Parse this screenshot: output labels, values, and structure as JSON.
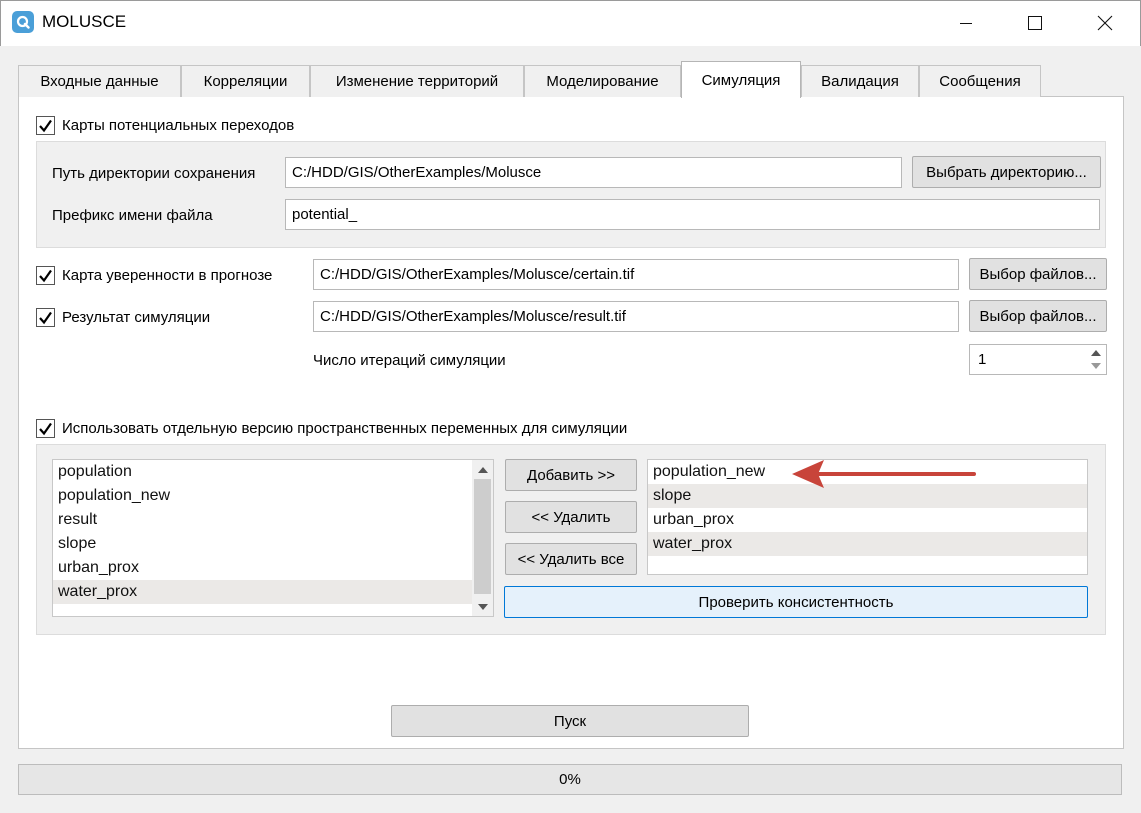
{
  "window": {
    "title": "MOLUSCE"
  },
  "tabs": [
    {
      "label": "Входные данные"
    },
    {
      "label": "Корреляции"
    },
    {
      "label": "Изменение территорий"
    },
    {
      "label": "Моделирование"
    },
    {
      "label": "Симуляция"
    },
    {
      "label": "Валидация"
    },
    {
      "label": "Сообщения"
    }
  ],
  "active_tab": "Симуляция",
  "potential": {
    "checkbox_label": "Карты потенциальных переходов",
    "checked": true,
    "dir_label": "Путь директории сохранения",
    "dir_value": "C:/HDD/GIS/OtherExamples/Molusce",
    "dir_button": "Выбрать директорию...",
    "prefix_label": "Префикс имени файла",
    "prefix_value": "potential_"
  },
  "certainty": {
    "checkbox_label": "Карта уверенности в прогнозе",
    "checked": true,
    "path": "C:/HDD/GIS/OtherExamples/Molusce/certain.tif",
    "button": "Выбор файлов..."
  },
  "result": {
    "checkbox_label": "Результат симуляции",
    "checked": true,
    "path": "C:/HDD/GIS/OtherExamples/Molusce/result.tif",
    "button": "Выбор файлов..."
  },
  "iterations": {
    "label": "Число итераций симуляции",
    "value": "1"
  },
  "separate_vars": {
    "checkbox_label": "Использовать отдельную версию пространственных переменных для симуляции",
    "checked": true,
    "available": [
      "population",
      "population_new",
      "result",
      "slope",
      "urban_prox",
      "water_prox"
    ],
    "available_selected_index": 5,
    "selected": [
      "population_new",
      "slope",
      "urban_prox",
      "water_prox"
    ],
    "add_button": "Добавить >>",
    "remove_button": "<< Удалить",
    "remove_all_button": "<< Удалить все",
    "check_button": "Проверить консистентность"
  },
  "run_button": "Пуск",
  "progress": {
    "text": "0%",
    "value": 0
  },
  "colors": {
    "annotation_arrow": "#c8443a",
    "accent": "#0078d7"
  }
}
